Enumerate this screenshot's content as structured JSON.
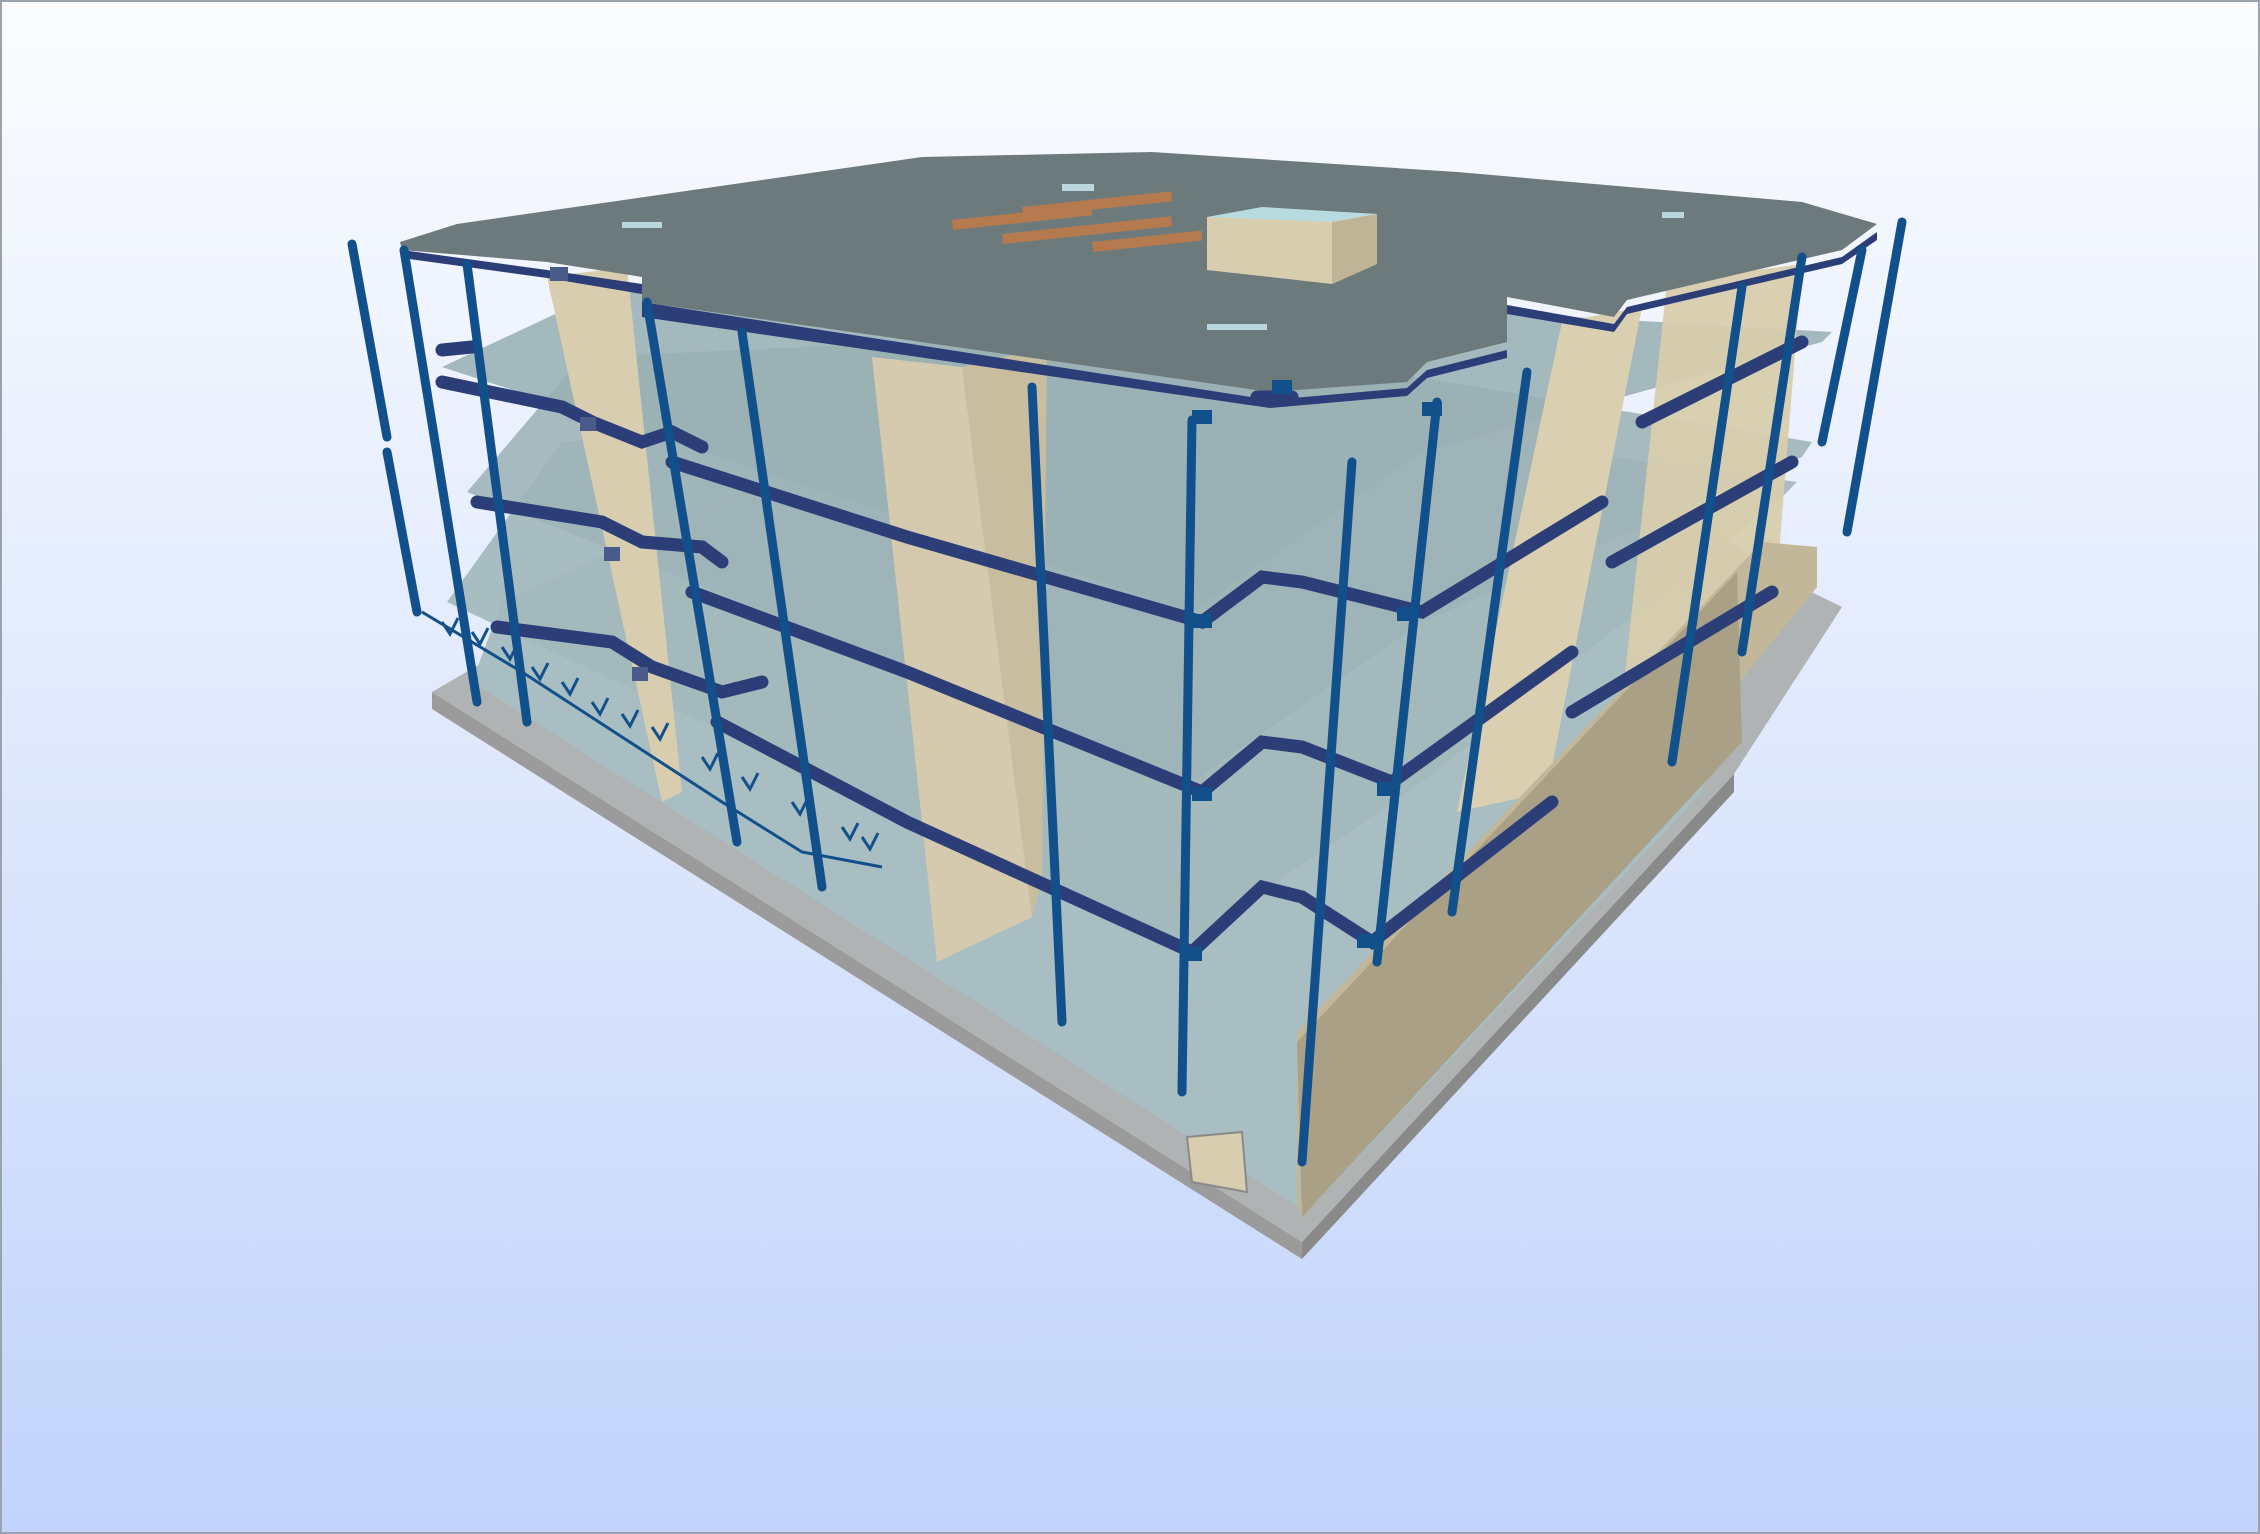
{
  "viewer": {
    "background_top": "#fbfcfe",
    "background_bottom": "#c2d4fb"
  },
  "model": {
    "column_color": "#12508c",
    "beam_color": "#2c3e78",
    "slab_color": "#a9bec2",
    "roof_color": "#6d7a7c",
    "wall_color": "#dccfb0",
    "base_color": "#9b9b9b",
    "opening_color": "#b9d7dc",
    "vent_color": "#b57a4e"
  }
}
